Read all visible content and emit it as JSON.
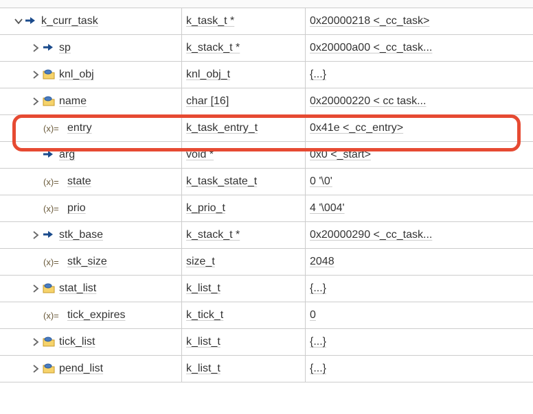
{
  "rows": [
    {
      "indent": 0,
      "expander": "open",
      "icon": "ptr",
      "name": "k_curr_task",
      "type": "k_task_t *",
      "value": "0x20000218 <_cc_task>"
    },
    {
      "indent": 1,
      "expander": "closed",
      "icon": "ptr",
      "name": "sp",
      "type": "k_stack_t *",
      "value": "0x20000a00 <_cc_task..."
    },
    {
      "indent": 1,
      "expander": "closed",
      "icon": "struct",
      "name": "knl_obj",
      "type": "knl_obj_t",
      "value": "{...}"
    },
    {
      "indent": 1,
      "expander": "closed",
      "icon": "struct",
      "name": "name",
      "type": "char [16]",
      "value": "0x20000220 < cc task..."
    },
    {
      "indent": 1,
      "expander": "none",
      "icon": "var",
      "name": "entry",
      "type": "k_task_entry_t",
      "value": "0x41e <_cc_entry>"
    },
    {
      "indent": 1,
      "expander": "none",
      "icon": "ptr",
      "name": "arg",
      "type": "void *",
      "value": "0x0 <_start>"
    },
    {
      "indent": 1,
      "expander": "none",
      "icon": "var",
      "name": "state",
      "type": "k_task_state_t",
      "value": "0 '\\0'"
    },
    {
      "indent": 1,
      "expander": "none",
      "icon": "var",
      "name": "prio",
      "type": "k_prio_t",
      "value": "4 '\\004'"
    },
    {
      "indent": 1,
      "expander": "closed",
      "icon": "ptr",
      "name": "stk_base",
      "type": "k_stack_t *",
      "value": "0x20000290 <_cc_task..."
    },
    {
      "indent": 1,
      "expander": "none",
      "icon": "var",
      "name": "stk_size",
      "type": "size_t",
      "value": "2048"
    },
    {
      "indent": 1,
      "expander": "closed",
      "icon": "struct",
      "name": "stat_list",
      "type": "k_list_t",
      "value": "{...}"
    },
    {
      "indent": 1,
      "expander": "none",
      "icon": "var",
      "name": "tick_expires",
      "type": "k_tick_t",
      "value": "0"
    },
    {
      "indent": 1,
      "expander": "closed",
      "icon": "struct",
      "name": "tick_list",
      "type": "k_list_t",
      "value": "{...}"
    },
    {
      "indent": 1,
      "expander": "closed",
      "icon": "struct",
      "name": "pend_list",
      "type": "k_list_t",
      "value": "{...}"
    }
  ],
  "highlight_row_index": 4
}
